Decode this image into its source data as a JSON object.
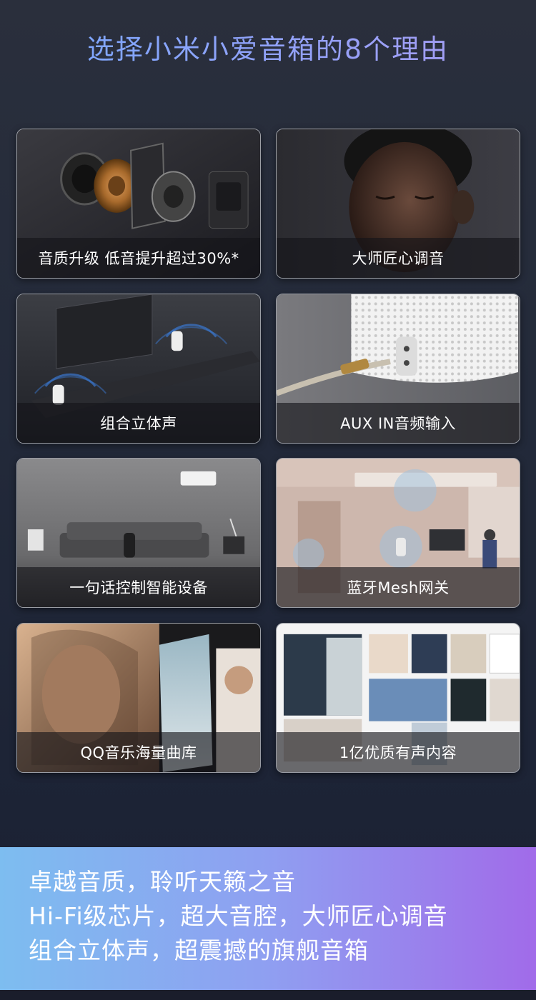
{
  "header": {
    "title": "选择小米小爱音箱的8个理由"
  },
  "cards": [
    {
      "caption": "音质升级 低音提升超过30%*",
      "image": "speaker-exploded-view"
    },
    {
      "caption": "大师匠心调音",
      "image": "listener-portrait"
    },
    {
      "caption": "组合立体声",
      "image": "stereo-pair-living-room"
    },
    {
      "caption": "AUX IN音频输入",
      "image": "aux-cable-port"
    },
    {
      "caption": "一句话控制智能设备",
      "image": "smart-home-room"
    },
    {
      "caption": "蓝牙Mesh网关",
      "image": "mesh-home-illustration"
    },
    {
      "caption": "QQ音乐海量曲库",
      "image": "music-album-covers"
    },
    {
      "caption": "1亿优质有声内容",
      "image": "audiobook-covers"
    }
  ],
  "banner": {
    "line1": "卓越音质，聆听天籁之音",
    "line2": "Hi-Fi级芯片，超大音腔，大师匠心调音",
    "line3": "组合立体声，超震撼的旗舰音箱"
  },
  "colors": {
    "title_gradient_start": "#78a8ff",
    "title_gradient_end": "#a99cf3",
    "banner_gradient_start": "#7dbdf0",
    "banner_gradient_end": "#a16be9",
    "background": "#232a3a"
  }
}
